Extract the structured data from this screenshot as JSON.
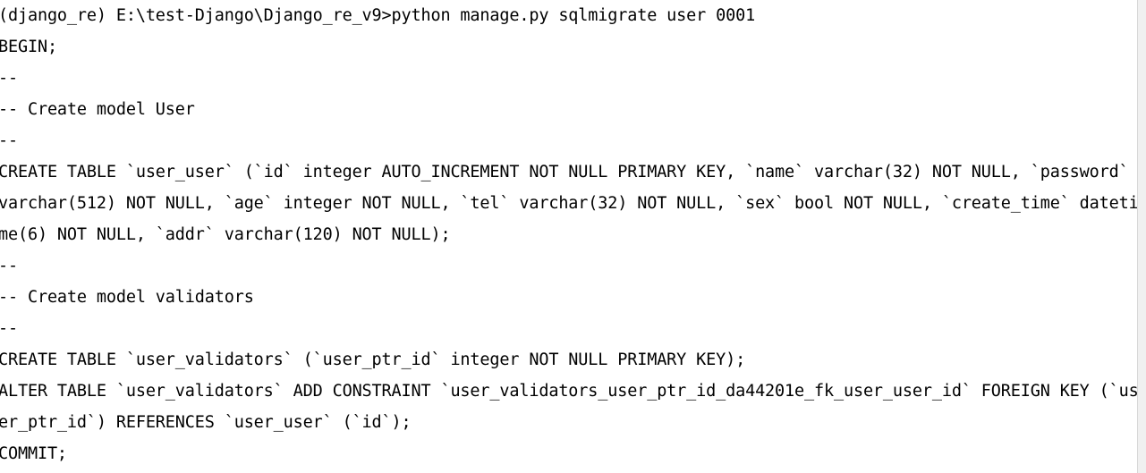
{
  "window": {
    "title": "Command Prompt",
    "background_color": "#ffffff",
    "text_color": "#000000",
    "scrollbar_track_color": "#f0f0f0",
    "scrollbar_thumb_color": "#cdcdcd"
  },
  "prompt": {
    "virtualenv": "(django_re)",
    "working_directory": "E:\\test-Django\\Django_re_v9",
    "separator": ">",
    "command": "python manage.py sqlmigrate user 0001",
    "full_line": "(django_re) E:\\test-Django\\Django_re_v9>python manage.py sqlmigrate user 0001"
  },
  "output": {
    "lines": [
      "(django_re) E:\\test-Django\\Django_re_v9>python manage.py sqlmigrate user 0001",
      "BEGIN;",
      "--",
      "-- Create model User",
      "--",
      "CREATE TABLE `user_user` (`id` integer AUTO_INCREMENT NOT NULL PRIMARY KEY, `name` varchar(32) NOT NULL, `password`",
      "varchar(512) NOT NULL, `age` integer NOT NULL, `tel` varchar(32) NOT NULL, `sex` bool NOT NULL, `create_time` dateti",
      "me(6) NOT NULL, `addr` varchar(120) NOT NULL);",
      "--",
      "-- Create model validators",
      "--",
      "CREATE TABLE `user_validators` (`user_ptr_id` integer NOT NULL PRIMARY KEY);",
      "ALTER TABLE `user_validators` ADD CONSTRAINT `user_validators_user_ptr_id_da44201e_fk_user_user_id` FOREIGN KEY (`us",
      "er_ptr_id`) REFERENCES `user_user` (`id`);",
      "COMMIT;"
    ]
  },
  "sql": {
    "statements": [
      "BEGIN;",
      "CREATE TABLE `user_user` (`id` integer AUTO_INCREMENT NOT NULL PRIMARY KEY, `name` varchar(32) NOT NULL, `password` varchar(512) NOT NULL, `age` integer NOT NULL, `tel` varchar(32) NOT NULL, `sex` bool NOT NULL, `create_time` datetime(6) NOT NULL, `addr` varchar(120) NOT NULL);",
      "CREATE TABLE `user_validators` (`user_ptr_id` integer NOT NULL PRIMARY KEY);",
      "ALTER TABLE `user_validators` ADD CONSTRAINT `user_validators_user_ptr_id_da44201e_fk_user_user_id` FOREIGN KEY (`user_ptr_id`) REFERENCES `user_user` (`id`);",
      "COMMIT;"
    ],
    "comments": [
      "-- Create model User",
      "-- Create model validators"
    ],
    "tables": [
      {
        "name": "user_user",
        "columns": [
          {
            "name": "id",
            "type": "integer",
            "attributes": "AUTO_INCREMENT NOT NULL PRIMARY KEY"
          },
          {
            "name": "name",
            "type": "varchar(32)",
            "attributes": "NOT NULL"
          },
          {
            "name": "password",
            "type": "varchar(512)",
            "attributes": "NOT NULL"
          },
          {
            "name": "age",
            "type": "integer",
            "attributes": "NOT NULL"
          },
          {
            "name": "tel",
            "type": "varchar(32)",
            "attributes": "NOT NULL"
          },
          {
            "name": "sex",
            "type": "bool",
            "attributes": "NOT NULL"
          },
          {
            "name": "create_time",
            "type": "datetime(6)",
            "attributes": "NOT NULL"
          },
          {
            "name": "addr",
            "type": "varchar(120)",
            "attributes": "NOT NULL"
          }
        ]
      },
      {
        "name": "user_validators",
        "columns": [
          {
            "name": "user_ptr_id",
            "type": "integer",
            "attributes": "NOT NULL PRIMARY KEY"
          }
        ]
      }
    ],
    "constraint": {
      "name": "user_validators_user_ptr_id_da44201e_fk_user_user_id",
      "hash": "da44201e",
      "on_table": "user_validators",
      "foreign_key": "user_ptr_id",
      "references_table": "user_user",
      "references_column": "id"
    }
  }
}
